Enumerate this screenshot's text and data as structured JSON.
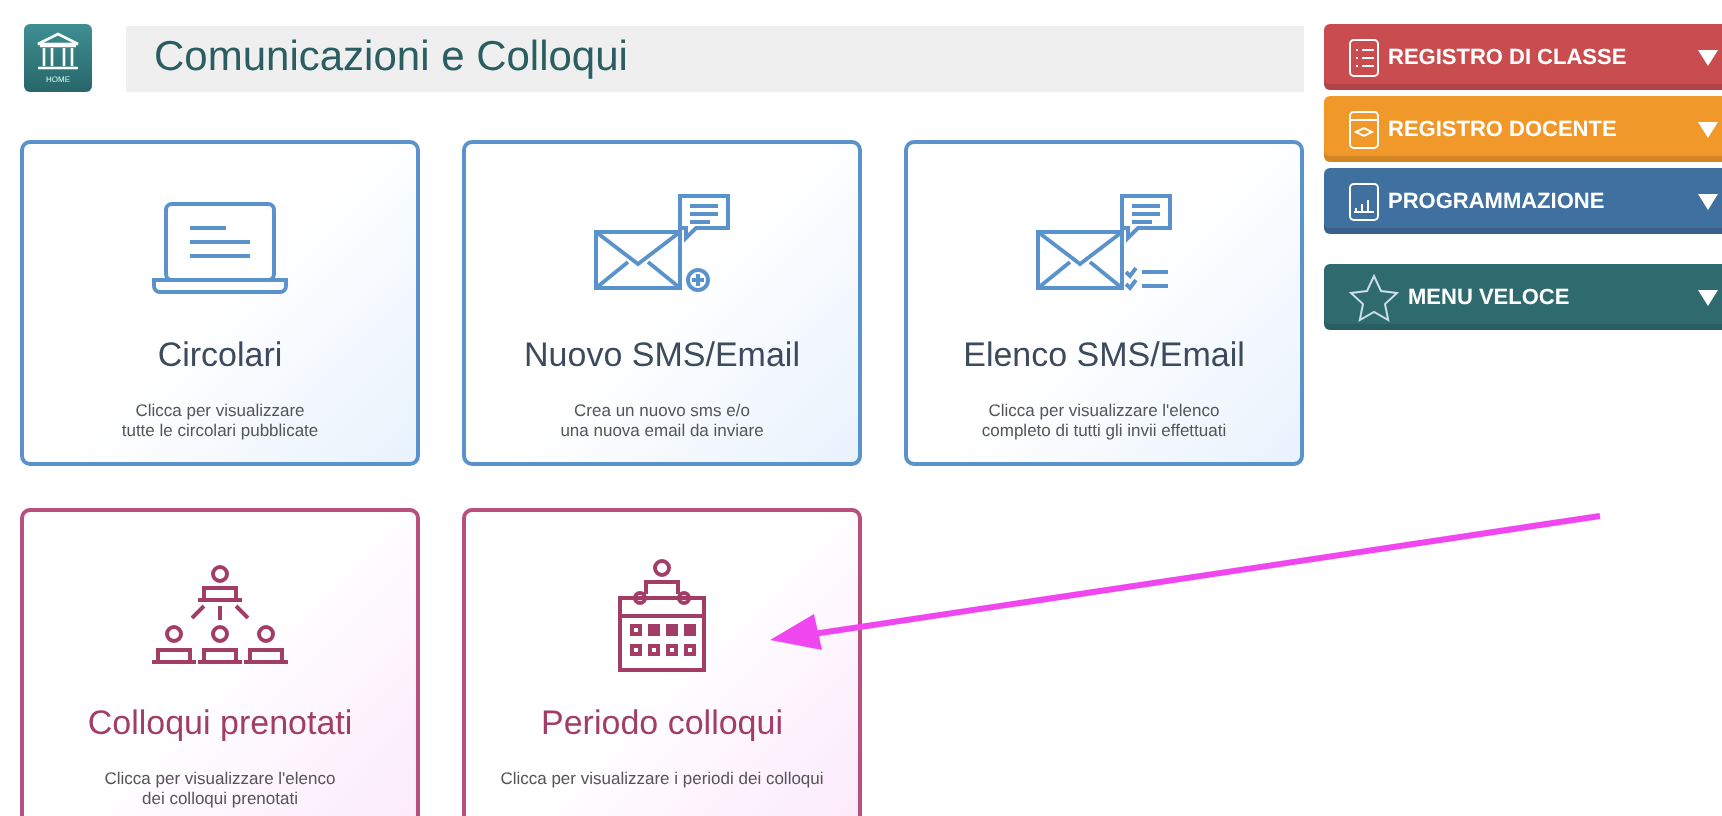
{
  "header": {
    "home_label": "HOME",
    "title": "Comunicazioni e Colloqui"
  },
  "cards": [
    {
      "kind": "blue",
      "title": "Circolari",
      "description": [
        "Clicca per visualizzare",
        "tutte le circolari pubblicate"
      ]
    },
    {
      "kind": "blue",
      "title": "Nuovo SMS/Email",
      "description": [
        "Crea un nuovo sms e/o",
        "una nuova email da inviare"
      ]
    },
    {
      "kind": "blue",
      "title": "Elenco SMS/Email",
      "description": [
        "Clicca per visualizzare l'elenco",
        "completo di tutti gli invii effettuati"
      ]
    },
    {
      "kind": "pink",
      "title": "Colloqui prenotati",
      "description": [
        "Clicca per visualizzare l'elenco",
        "dei colloqui prenotati"
      ]
    },
    {
      "kind": "pink",
      "title": "Periodo colloqui",
      "description": [
        "Clicca per visualizzare i periodi dei colloqui"
      ]
    }
  ],
  "sidebar": {
    "items": [
      {
        "label": "REGISTRO DI CLASSE",
        "color": "#c94d4f"
      },
      {
        "label": "REGISTRO DOCENTE",
        "color": "#f0992a"
      },
      {
        "label": "PROGRAMMAZIONE",
        "color": "#40709f"
      },
      {
        "label": "MENU VELOCE",
        "color": "#2f6b6e"
      }
    ]
  }
}
